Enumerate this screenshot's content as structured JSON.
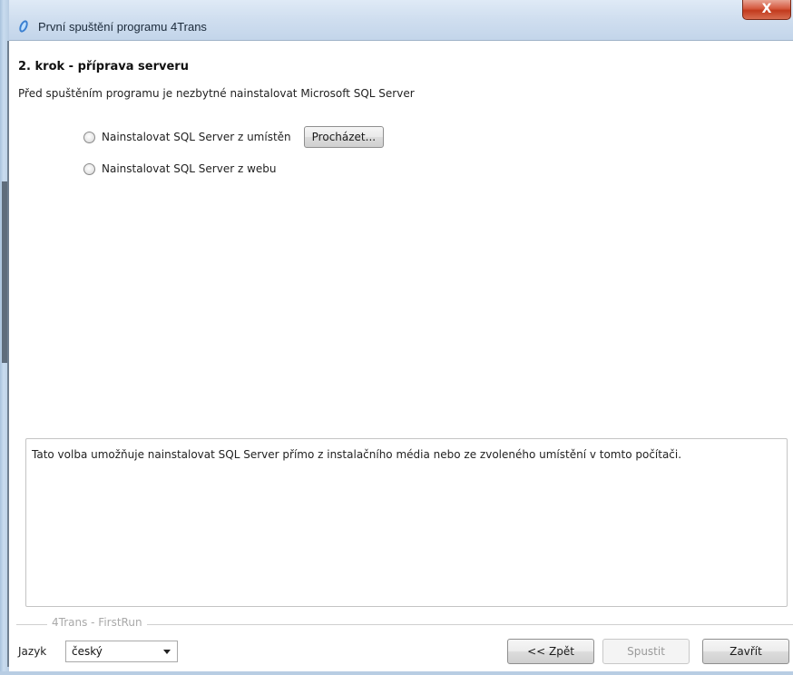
{
  "window": {
    "title": "První spuštění programu 4Trans",
    "close_label": "X"
  },
  "step": {
    "title": "2. krok - příprava serveru",
    "description": "Před spuštěním programu je nezbytné nainstalovat Microsoft SQL Server"
  },
  "options": [
    {
      "label": "Nainstalovat SQL Server z umístěn",
      "selected": false
    },
    {
      "label": "Nainstalovat SQL Server z webu",
      "selected": false
    }
  ],
  "browse_label": "Procházet...",
  "info_text": "Tato volba umožňuje nainstalovat SQL Server přímo z instalačního média nebo ze zvoleného umístění v tomto počítači.",
  "group_label": "4Trans - FirstRun",
  "language": {
    "label": "Jazyk",
    "value": "český"
  },
  "buttons": {
    "back": "<< Zpět",
    "run": "Spustit",
    "close": "Zavřít"
  },
  "colors": {
    "titlebar": "#cfdeef",
    "close_button": "#c23a1d",
    "disabled_text": "#9a9a9a"
  }
}
